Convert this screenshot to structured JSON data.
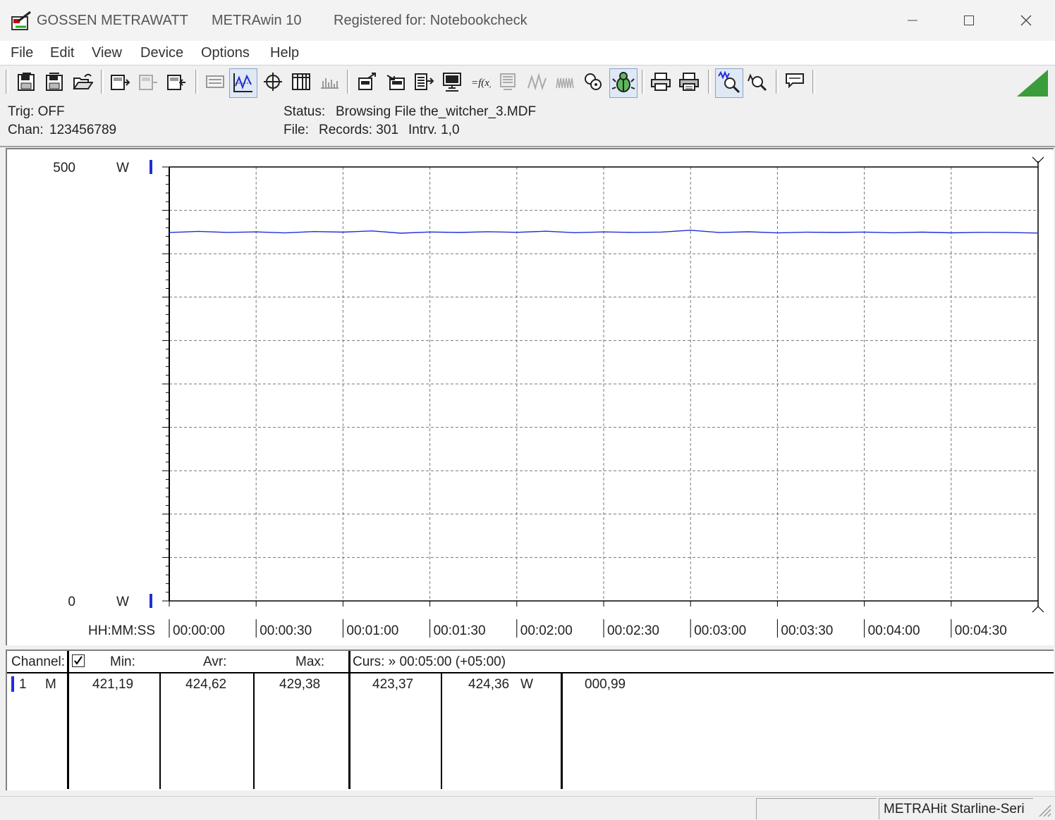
{
  "window": {
    "brand": "GOSSEN METRAWATT",
    "app": "METRAwin 10",
    "registration": "Registered for: Notebookcheck"
  },
  "menu": [
    "File",
    "Edit",
    "View",
    "Device",
    "Options",
    "Help"
  ],
  "toolbar": {
    "icons": [
      "save-icon",
      "save-as-icon",
      "open-icon",
      "device-read-icon",
      "device-disabled-icon",
      "device-write-icon",
      "list-view-icon",
      "chart-view-icon",
      "cursor-icon",
      "table-view-icon",
      "histogram-icon",
      "export-icon",
      "import-icon",
      "analysis-icon",
      "monitor-icon",
      "formula-icon",
      "disabled-a-icon",
      "wave-icon",
      "wave-disabled-icon",
      "settings-icon",
      "bug-icon",
      "print-icon",
      "print-preview-icon",
      "zoom-in-icon",
      "zoom-out-icon",
      "comment-icon"
    ]
  },
  "status": {
    "trig": "Trig: OFF",
    "chan_label": "Chan:",
    "chan_value": "123456789",
    "status_label": "Status:",
    "status_value": "Browsing File the_witcher_3.MDF",
    "file_label": "File:",
    "records": "Records: 301",
    "interval": "Intrv. 1,0"
  },
  "chart_data": {
    "type": "line",
    "y_top_label": "500",
    "y_bottom_label": "0",
    "y_unit": "W",
    "xlabel": "HH:MM:SS",
    "ylim": [
      0,
      500
    ],
    "xlim_seconds": [
      0,
      300
    ],
    "x_ticks": [
      "00:00:00",
      "00:00:30",
      "00:01:00",
      "00:01:30",
      "00:02:00",
      "00:02:30",
      "00:03:00",
      "00:03:30",
      "00:04:00",
      "00:04:30"
    ],
    "grid": true,
    "series": [
      {
        "color": "#1f2fd8",
        "x": [
          0,
          10,
          20,
          30,
          40,
          50,
          60,
          70,
          80,
          90,
          100,
          110,
          120,
          130,
          140,
          150,
          160,
          170,
          180,
          190,
          200,
          210,
          220,
          230,
          240,
          250,
          260,
          270,
          280,
          290,
          300
        ],
        "y": [
          424.4,
          425.8,
          424.6,
          425.2,
          424.0,
          425.6,
          424.9,
          426.3,
          423.7,
          425.1,
          424.5,
          425.4,
          424.7,
          426.0,
          424.3,
          425.2,
          424.6,
          425.0,
          427.1,
          424.4,
          425.3,
          424.0,
          424.8,
          424.5,
          425.0,
          424.2,
          424.9,
          424.1,
          424.7,
          424.4,
          423.9
        ]
      }
    ]
  },
  "table": {
    "header": {
      "channel": "Channel:",
      "min": "Min:",
      "avr": "Avr:",
      "max": "Max:",
      "cursor": "Curs: » 00:05:00 (+05:00)"
    },
    "row": {
      "num": "1",
      "mode": "M",
      "min": "421,19",
      "avr": "424,62",
      "max": "429,38",
      "curs1": "423,37",
      "curs2": "424,36",
      "unit": "W",
      "extra": "000,99"
    }
  },
  "statusbar": {
    "device": "METRAHit Starline-Seri"
  },
  "colors": {
    "series": "#1f2fd8",
    "accent_green": "#3a9c3a"
  }
}
